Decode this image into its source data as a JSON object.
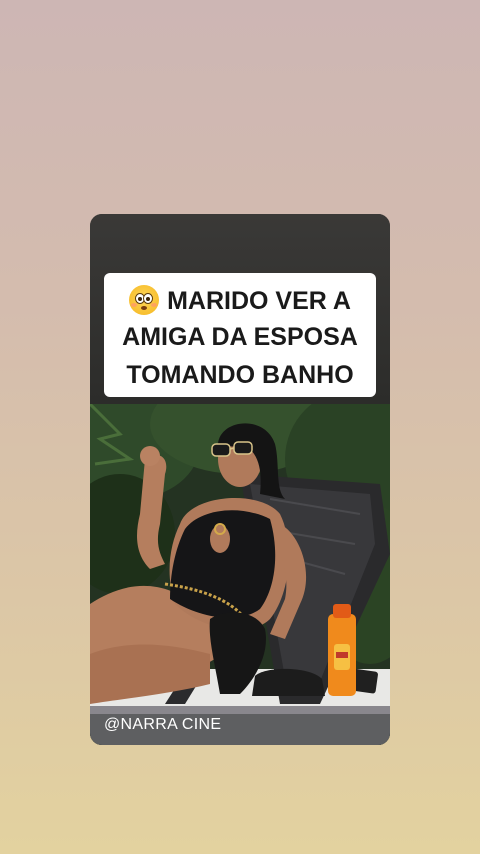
{
  "story": {
    "caption": {
      "emoji": "flushed-face-icon",
      "line1": "MARIDO VER A",
      "line2": "AMIGA DA ESPOSA",
      "line3": "TOMANDO BANHO"
    },
    "video": {
      "description_icon": "video-frame"
    },
    "watermark": "@NARRA CINE"
  },
  "colors": {
    "background_top": "#cdb6b4",
    "background_bottom": "#e3d29f",
    "caption_bg": "#ffffff",
    "caption_text": "#1a1a1a",
    "watermark_text": "#ffffff"
  }
}
